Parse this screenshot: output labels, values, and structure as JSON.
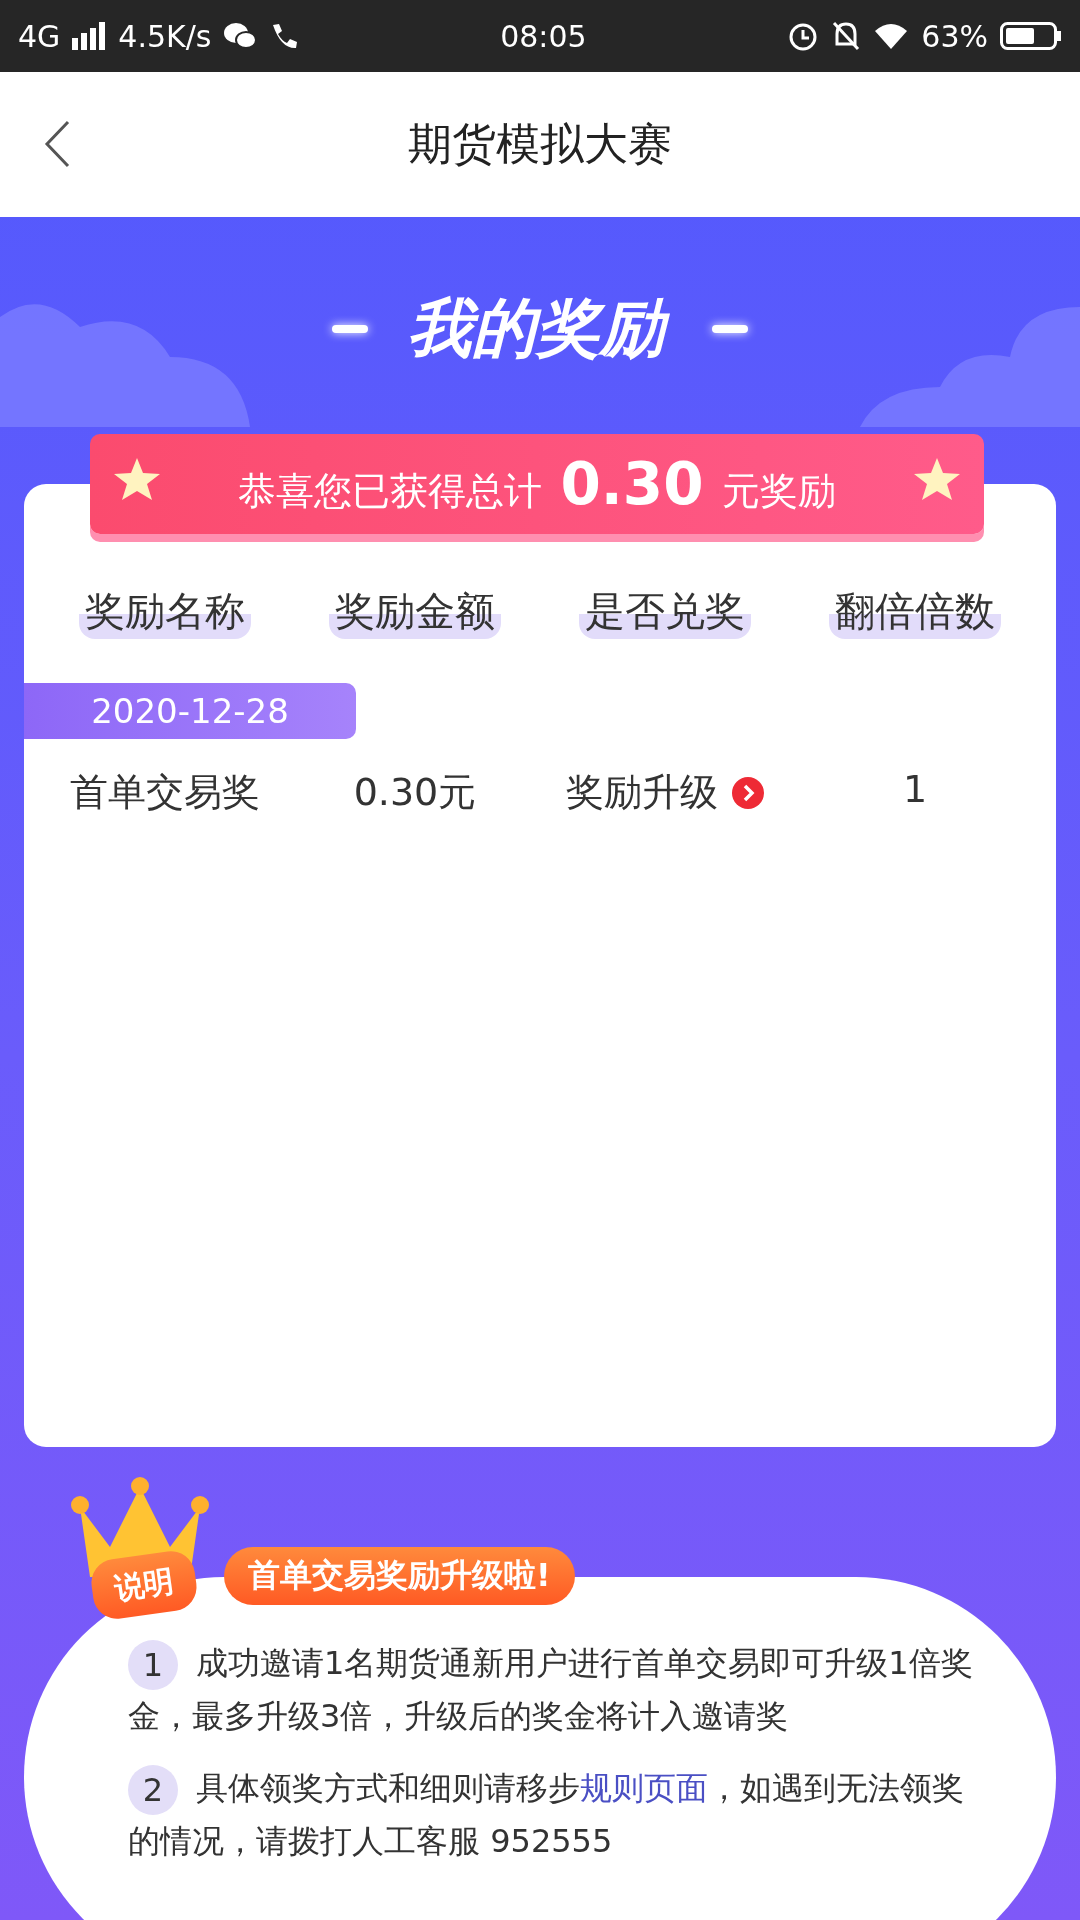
{
  "status_bar": {
    "network": "4G",
    "speed": "4.5K/s",
    "time": "08:05",
    "battery": "63%"
  },
  "header": {
    "title": "期货模拟大赛"
  },
  "rewards": {
    "title": "我的奖励",
    "summary": "恭喜您已获得总计 **0.30** 元奖励",
    "columns": [
      "奖励名称",
      "奖励金额",
      "是否兑奖",
      "翻倍倍数"
    ],
    "groups": [
      {
        "date": "2020-12-28",
        "rows": [
          {
            "name": "首单交易奖",
            "amount": "0.30元",
            "status": "奖励升级",
            "multiplier": "1"
          }
        ]
      }
    ]
  },
  "notes": {
    "badge": "说明",
    "title": "首单交易奖励升级啦!",
    "items": [
      {
        "number": "1",
        "text": "成功邀请1名期货通新用户进行首单交易即可升级1倍奖金，最多升级3倍，升级后的奖金将计入邀请奖"
      },
      {
        "number": "2",
        "text": "具体领奖方式和细则请移步",
        "link": "规则页面",
        "text_after": "，如遇到无法领奖的情况，请拨打人工客服 952555"
      }
    ]
  }
}
